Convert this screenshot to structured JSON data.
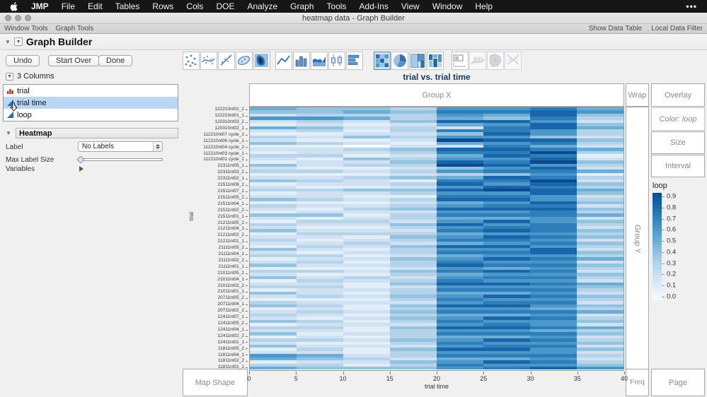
{
  "menu_bar": {
    "items": [
      "JMP",
      "File",
      "Edit",
      "Tables",
      "Rows",
      "Cols",
      "DOE",
      "Analyze",
      "Graph",
      "Tools",
      "Add-Ins",
      "View",
      "Window",
      "Help"
    ],
    "more": "•••"
  },
  "title_bar": {
    "title": "heatmap data - Graph Builder"
  },
  "tool_strip": {
    "left": [
      "Window Tools",
      "Graph Tools"
    ],
    "right": [
      "Show Data Table",
      "Local Data Filter"
    ]
  },
  "gb": {
    "title": "Graph Builder",
    "buttons": {
      "undo": "Undo",
      "start_over": "Start Over",
      "done": "Done"
    },
    "columns_header": "3 Columns",
    "columns": [
      {
        "name": "trial"
      },
      {
        "name": "trial time"
      },
      {
        "name": "loop"
      }
    ],
    "heatmap_panel": {
      "title": "Heatmap",
      "label_label": "Label",
      "label_value": "No Labels",
      "max_label_size_label": "Max Label Size",
      "variables_label": "Variables"
    }
  },
  "zones": {
    "group_x": "Group X",
    "group_y": "Group Y",
    "wrap": "Wrap",
    "overlay": "Overlay",
    "color": "Color: loop",
    "size": "Size",
    "interval": "Interval",
    "map_shape": "Map Shape",
    "freq": "Freq",
    "page": "Page"
  },
  "chart_data": {
    "type": "heatmap",
    "title": "trial vs. trial time",
    "xlabel": "trial time",
    "ylabel": "trial",
    "x_ticks": [
      "0",
      "5",
      "10",
      "15",
      "20",
      "25",
      "30",
      "35",
      "40"
    ],
    "x_range": [
      0,
      40
    ],
    "legend": {
      "title": "loop",
      "ticks": [
        "0.9",
        "0.8",
        "0.7",
        "0.6",
        "0.5",
        "0.4",
        "0.3",
        "0.2",
        "0.1",
        "0.0"
      ],
      "domain": [
        0,
        1
      ]
    },
    "palette": [
      "#f7fbff",
      "#e2eef8",
      "#cfe1f2",
      "#b5d4e9",
      "#93c3df",
      "#6badd6",
      "#4b97c9",
      "#2f7ebc",
      "#1865aa",
      "#0b4a8f"
    ],
    "y_labels": [
      "122210nt02_2",
      "122210nt01_1",
      "120310nt03_2",
      "120310nt02_1",
      "112210nt07 cycle_2",
      "112210nt06 cycle_1",
      "112210nt04 cycle_2",
      "112210nt03 cycle_1",
      "112210nt01 cycle_2",
      "22311nt05_1",
      "22311nt03_2",
      "22311nt02_1",
      "21511nt08_2",
      "21511nt07_1",
      "21511nt05_2",
      "21511nt04_1",
      "21511nt02_2",
      "21511nt01_1",
      "21211nt05_2",
      "21211nt04_1",
      "21211nt02_2",
      "21211nt01_1",
      "21111nt05_2",
      "21111nt04_1",
      "21111nt02_2",
      "21111nt01_1",
      "21011nt05_2",
      "21011nt04_1",
      "21011nt02_2",
      "21011nt01_1",
      "20711nt05_2",
      "20711nt04_1",
      "20711nt02_2",
      "12411nt07_1",
      "12411nt05_2",
      "12411nt04_1",
      "12411nt02_2",
      "12411nt01_1",
      "11811nt05_2",
      "11811nt04_1",
      "11811nt02_2",
      "11811nt01_1"
    ],
    "rows": [
      "54436675",
      "44547786",
      "23336584",
      "66535473",
      "23248862",
      "12125684",
      "54232785",
      "23137763",
      "11224863",
      "32436642",
      "21129884",
      "43215673",
      "11022752",
      "22348875",
      "12237793",
      "33125871",
      "21436682",
      "12248794",
      "42339863",
      "21124682",
      "33236775",
      "11123461",
      "22345873",
      "43217792",
      "12238684",
      "21126873",
      "33448985",
      "12236684",
      "22117762",
      "43238863",
      "11125684",
      "32236772",
      "21348884",
      "12226673",
      "44137775",
      "21235562",
      "13326864",
      "32248673",
      "21136772",
      "42227874",
      "13335663",
      "22146874",
      "31237762",
      "22325674",
      "13248863",
      "42136682",
      "21237784",
      "33125663",
      "12246875",
      "23137662",
      "42238774",
      "11126563",
      "33247872",
      "21135664",
      "42326773",
      "13237662",
      "22148875",
      "33126664",
      "12237773",
      "42135562",
      "23246874",
      "11137663",
      "32226772",
      "43148864",
      "12136653",
      "23247775",
      "32135562",
      "21246873",
      "43137664",
      "12226762",
      "33148875",
      "22136653",
      "41237774",
      "12135562",
      "33246873",
      "21137664",
      "42226772",
      "13148864",
      "22136662",
      "65237773",
      "54325562",
      "12246873",
      "33137664",
      "54446786"
    ]
  }
}
